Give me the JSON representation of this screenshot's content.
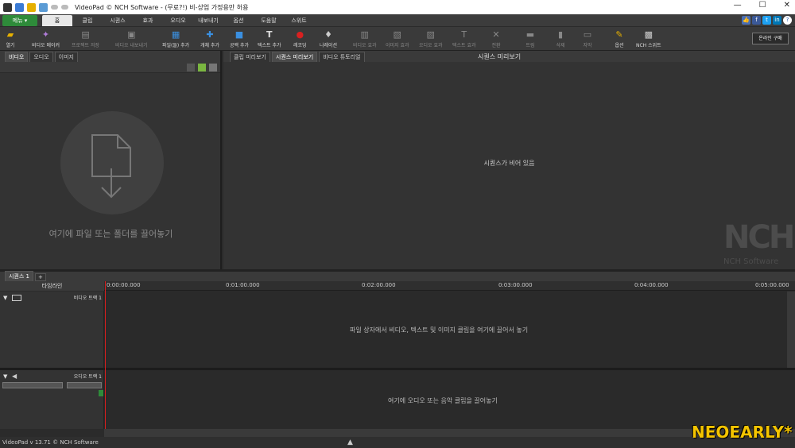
{
  "window": {
    "title": "VideoPad © NCH Software - (무료?!) 비-상업 가정용만 허용",
    "minimize": "—",
    "maximize": "☐",
    "close": "✕"
  },
  "menu": {
    "menu_button": "메뉴 ▾",
    "tabs": [
      "홈",
      "클립",
      "시퀀스",
      "효과",
      "오디오",
      "내보내기",
      "옵션",
      "도움말",
      "스위트"
    ]
  },
  "toolbar": {
    "items": [
      {
        "label": "열기",
        "icon": "folder-icon"
      },
      {
        "label": "비디오 메이커",
        "icon": "wand-icon"
      },
      {
        "label": "프로젝트 저장",
        "icon": "save-icon"
      },
      {
        "label": "비디오 내보내기",
        "icon": "export-icon"
      },
      {
        "label": "파일(들) 추가",
        "icon": "add-file-icon"
      },
      {
        "label": "개체 추가",
        "icon": "add-object-icon"
      },
      {
        "label": "공백 추가",
        "icon": "add-blank-icon"
      },
      {
        "label": "텍스트 추가",
        "icon": "text-icon"
      },
      {
        "label": "레코딩",
        "icon": "record-icon"
      },
      {
        "label": "나레이션",
        "icon": "microphone-icon"
      },
      {
        "label": "비디오 효과",
        "icon": "video-fx-icon"
      },
      {
        "label": "이미지 효과",
        "icon": "image-fx-icon"
      },
      {
        "label": "오디오 효과",
        "icon": "audio-fx-icon"
      },
      {
        "label": "텍스트 효과",
        "icon": "text-fx-icon"
      },
      {
        "label": "전환",
        "icon": "transition-icon"
      },
      {
        "label": "트림",
        "icon": "trim-icon"
      },
      {
        "label": "삭제",
        "icon": "delete-icon"
      },
      {
        "label": "자막",
        "icon": "subtitle-icon"
      },
      {
        "label": "옵션",
        "icon": "options-icon"
      },
      {
        "label": "NCH 스위트",
        "icon": "suite-icon"
      }
    ],
    "buy_label": "온라인 구매"
  },
  "bin": {
    "tabs": [
      "비디오",
      "오디오",
      "이미지"
    ],
    "drop_text": "여기에 파일 또는 폴더를 끌어놓기"
  },
  "preview": {
    "tabs": [
      "클립 미리보기",
      "시퀀스 미리보기",
      "비디오 튜토리얼"
    ],
    "title": "시퀀스 미리보기",
    "empty_text": "시퀀스가 비어 있음",
    "logo_text": "NCH",
    "logo_sub": "NCH Software"
  },
  "timeline": {
    "sequence_tab": "시퀀스 1",
    "add_tab": "+",
    "label": "타임라인",
    "ticks": [
      "0:00:00.000",
      "0:01:00.000",
      "0:02:00.000",
      "0:03:00.000",
      "0:04:00.000",
      "0:05:00.000"
    ],
    "video_track_label": "비디오 트랙 1",
    "video_hint": "파일 상자에서 비디오, 텍스트 및 이미지 클립을 여기에 끌어서 놓기",
    "audio_track_label": "오디오 트랙 1",
    "audio_hint": "여기에 오디오 또는 음악 클립을 끌어놓기"
  },
  "status": {
    "version": "VideoPad v 13.71 © NCH Software"
  },
  "watermark": "NEOEARLY*"
}
